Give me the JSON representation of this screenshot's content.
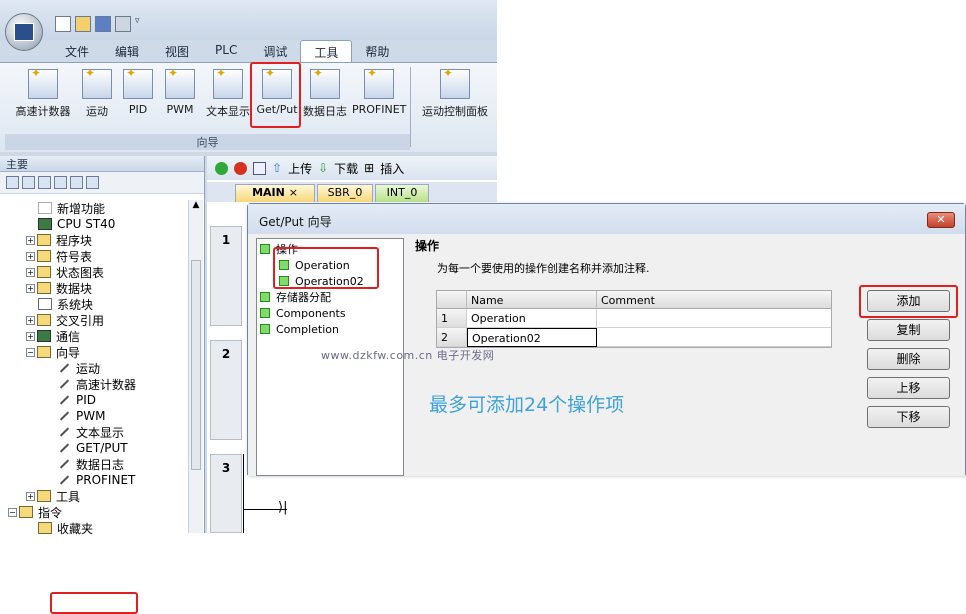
{
  "menu_tabs": [
    "文件",
    "编辑",
    "视图",
    "PLC",
    "调试",
    "工具",
    "帮助"
  ],
  "active_tab_index": 5,
  "ribbon": {
    "buttons": [
      "高速计数器",
      "运动",
      "PID",
      "PWM",
      "文本显示",
      "Get/Put",
      "数据日志",
      "PROFINET",
      "运动控制面板"
    ],
    "group_label": "向导"
  },
  "left_pane": {
    "title": "主要",
    "tree": [
      {
        "label": "新增功能",
        "icon": "question-icon",
        "level": 1
      },
      {
        "label": "CPU ST40",
        "icon": "cpu-icon",
        "level": 1
      },
      {
        "label": "程序块",
        "icon": "folder-icon",
        "level": 1,
        "expand": "+"
      },
      {
        "label": "符号表",
        "icon": "folder-icon",
        "level": 1,
        "expand": "+"
      },
      {
        "label": "状态图表",
        "icon": "folder-icon",
        "level": 1,
        "expand": "+"
      },
      {
        "label": "数据块",
        "icon": "folder-icon",
        "level": 1,
        "expand": "+"
      },
      {
        "label": "系统块",
        "icon": "doc-icon",
        "level": 1
      },
      {
        "label": "交叉引用",
        "icon": "folder-icon",
        "level": 1,
        "expand": "+"
      },
      {
        "label": "通信",
        "icon": "network-icon",
        "level": 1,
        "expand": "+"
      },
      {
        "label": "向导",
        "icon": "wizard-folder-icon",
        "level": 1,
        "expand": "−"
      },
      {
        "label": "运动",
        "icon": "wand-icon",
        "level": 2
      },
      {
        "label": "高速计数器",
        "icon": "wand-icon",
        "level": 2
      },
      {
        "label": "PID",
        "icon": "wand-icon",
        "level": 2
      },
      {
        "label": "PWM",
        "icon": "wand-icon",
        "level": 2
      },
      {
        "label": "文本显示",
        "icon": "wand-icon",
        "level": 2
      },
      {
        "label": "GET/PUT",
        "icon": "wand-icon",
        "level": 2
      },
      {
        "label": "数据日志",
        "icon": "wand-icon",
        "level": 2
      },
      {
        "label": "PROFINET",
        "icon": "wand-icon",
        "level": 2
      },
      {
        "label": "工具",
        "icon": "folder-icon",
        "level": 1,
        "expand": "+"
      },
      {
        "label": "指令",
        "icon": "folder-icon",
        "level": 0,
        "expand": "−"
      },
      {
        "label": "收藏夹",
        "icon": "folder-icon",
        "level": 1
      }
    ]
  },
  "editor": {
    "toolbar": {
      "upload": "上传",
      "download": "下载",
      "insert": "插入"
    },
    "tabs": [
      "MAIN",
      "SBR_0",
      "INT_0"
    ],
    "rungs": [
      "1",
      "2",
      "3"
    ]
  },
  "dialog": {
    "title": "Get/Put 向导",
    "close": "✕",
    "steps": [
      {
        "label": "操作",
        "level": 0
      },
      {
        "label": "Operation",
        "level": 1
      },
      {
        "label": "Operation02",
        "level": 1
      },
      {
        "label": "存储器分配",
        "level": 0
      },
      {
        "label": "Components",
        "level": 0
      },
      {
        "label": "Completion",
        "level": 0
      }
    ],
    "heading": "操作",
    "description": "为每一个要使用的操作创建名称并添加注释.",
    "grid": {
      "columns": [
        "Name",
        "Comment"
      ],
      "rows": [
        {
          "num": "1",
          "name": "Operation",
          "comment": ""
        },
        {
          "num": "2",
          "name": "Operation02",
          "comment": ""
        }
      ]
    },
    "buttons": {
      "add": "添加",
      "copy": "复制",
      "delete": "删除",
      "up": "上移",
      "down": "下移"
    },
    "watermark": "www.dzkfw.com.cn 电子开发网",
    "note": "最多可添加24个操作项"
  }
}
